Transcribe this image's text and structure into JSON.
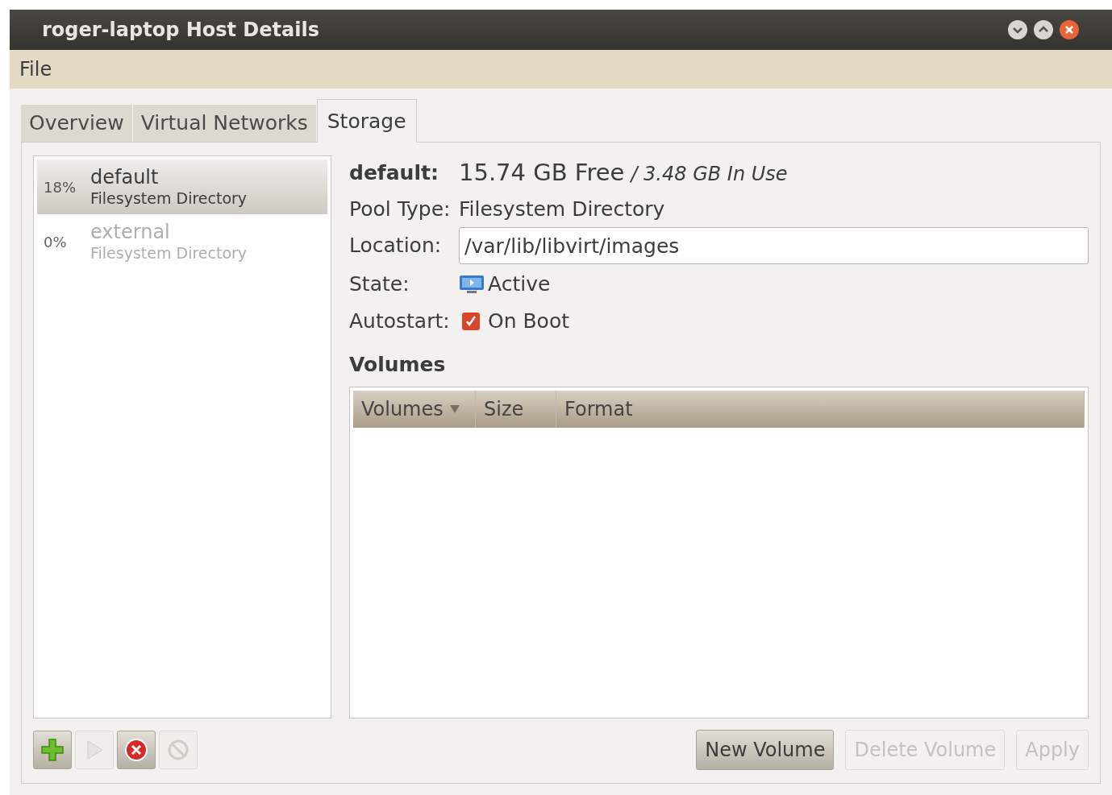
{
  "window": {
    "title": "roger-laptop Host Details"
  },
  "menu": [
    "File"
  ],
  "tabs": [
    {
      "label": "Overview",
      "selected": false
    },
    {
      "label": "Virtual Networks",
      "selected": false
    },
    {
      "label": "Storage",
      "selected": true
    }
  ],
  "pools": [
    {
      "usage": "18%",
      "name": "default",
      "type": "Filesystem Directory",
      "selected": true,
      "active": true
    },
    {
      "usage": "0%",
      "name": "external",
      "type": "Filesystem Directory",
      "selected": false,
      "active": false
    }
  ],
  "pool_buttons": [
    {
      "kind": "add",
      "disabled": false
    },
    {
      "kind": "start",
      "disabled": true
    },
    {
      "kind": "stop",
      "disabled": false
    },
    {
      "kind": "delete",
      "disabled": true
    }
  ],
  "details": {
    "name": "default:",
    "free": "15.74 GB Free",
    "in_use": "/ 3.48 GB In Use",
    "pool_type": {
      "label": "Pool Type:",
      "value": "Filesystem Directory"
    },
    "location": {
      "label": "Location:",
      "value": "/var/lib/libvirt/images"
    },
    "state": {
      "label": "State:",
      "value": "Active"
    },
    "autostart": {
      "label": "Autostart:",
      "text": "On Boot",
      "checked": true
    }
  },
  "volumes": {
    "heading": "Volumes",
    "columns": [
      {
        "label": "Volumes",
        "sorted": true
      },
      {
        "label": "Size",
        "sorted": false
      },
      {
        "label": "Format",
        "sorted": false
      }
    ]
  },
  "buttons": [
    {
      "label": "New Volume",
      "disabled": false
    },
    {
      "label": "Delete Volume",
      "disabled": true
    },
    {
      "label": "Apply",
      "disabled": true
    }
  ]
}
